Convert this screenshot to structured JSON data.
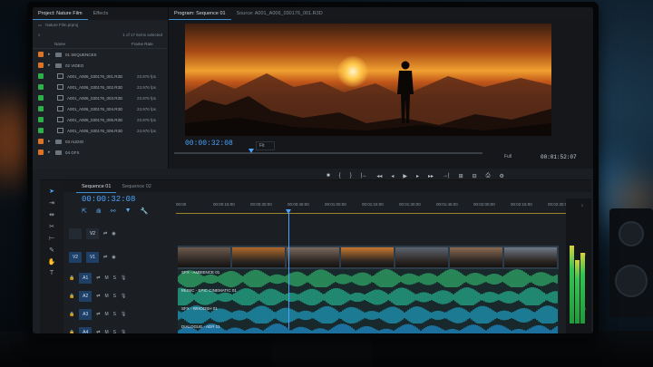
{
  "project_panel": {
    "tab_project": "Project: Nature Film",
    "tab_effects": "Effects",
    "file": "Nature Film.prproj",
    "selection": "1 of 17 items selected",
    "col_name": "Name",
    "col_fps": "Frame Rate",
    "items": [
      {
        "name": "01 SEQUENCES",
        "type": "folder",
        "color": "#d9742a",
        "fps": ""
      },
      {
        "name": "02 VIDEO",
        "type": "folder",
        "color": "#d9742a",
        "fps": ""
      },
      {
        "name": "A001_A006_030176_001.R3D",
        "type": "clip",
        "color": "#2fae4e",
        "fps": "23.976 fps"
      },
      {
        "name": "A001_A006_030176_002.R3D",
        "type": "clip",
        "color": "#2fae4e",
        "fps": "23.976 fps"
      },
      {
        "name": "A001_A006_030176_003.R3D",
        "type": "clip",
        "color": "#2fae4e",
        "fps": "23.976 fps"
      },
      {
        "name": "A001_A006_030176_004.R3D",
        "type": "clip",
        "color": "#2fae4e",
        "fps": "23.976 fps"
      },
      {
        "name": "A001_A006_030176_005.R3D",
        "type": "clip",
        "color": "#2fae4e",
        "fps": "23.976 fps"
      },
      {
        "name": "A001_A006_030176_006.R3D",
        "type": "clip",
        "color": "#2fae4e",
        "fps": "23.976 fps"
      },
      {
        "name": "03 AUDIO",
        "type": "folder",
        "color": "#d9742a",
        "fps": ""
      },
      {
        "name": "04 GFX",
        "type": "folder",
        "color": "#d9742a",
        "fps": ""
      }
    ]
  },
  "program_monitor": {
    "tab_program": "Program: Sequence 01",
    "tab_source": "Source: A001_A006_030176_001.R3D",
    "timecode": "00:00:32:08",
    "fit": "Fit",
    "full": "Full",
    "duration": "00:01:52:07"
  },
  "transport": [
    "■",
    "{",
    "}",
    "|←",
    "◂◂",
    "◂",
    "▶",
    "▸",
    "▸▸",
    "→|",
    "⊞",
    "⊟",
    "⎙",
    "⚙"
  ],
  "timeline": {
    "tab_seq1": "Sequence 01",
    "tab_seq2": "Sequence 02",
    "timecode": "00:00:32:08",
    "ruler": [
      "00:00",
      "00:00:15:00",
      "00:00:30:00",
      "00:00:45:00",
      "00:01:00:00",
      "00:01:15:00",
      "00:01:30:00",
      "00:01:45:00",
      "00:02:00:00",
      "00:02:15:00",
      "00:02:30:00"
    ],
    "video_tracks": [
      {
        "id": "V2",
        "source": "",
        "active": false
      },
      {
        "id": "V1",
        "source": "V2",
        "active": true
      }
    ],
    "audio_tracks": [
      {
        "id": "A1",
        "clip": "SFX - AMBIENCE 01",
        "color": "#2fae6a"
      },
      {
        "id": "A2",
        "clip": "MUSIC - EPIC CINEMATIC 01",
        "color": "#25b08f"
      },
      {
        "id": "A3",
        "clip": "SFX - WHOOSH 01",
        "color": "#1f9fc0"
      },
      {
        "id": "A4",
        "clip": "DIALOGUE - ADR 01",
        "color": "#1f8fd0"
      }
    ],
    "track_controls": {
      "mute": "M",
      "solo": "S"
    },
    "meter_levels": [
      0.72,
      0.58,
      0.65
    ]
  }
}
